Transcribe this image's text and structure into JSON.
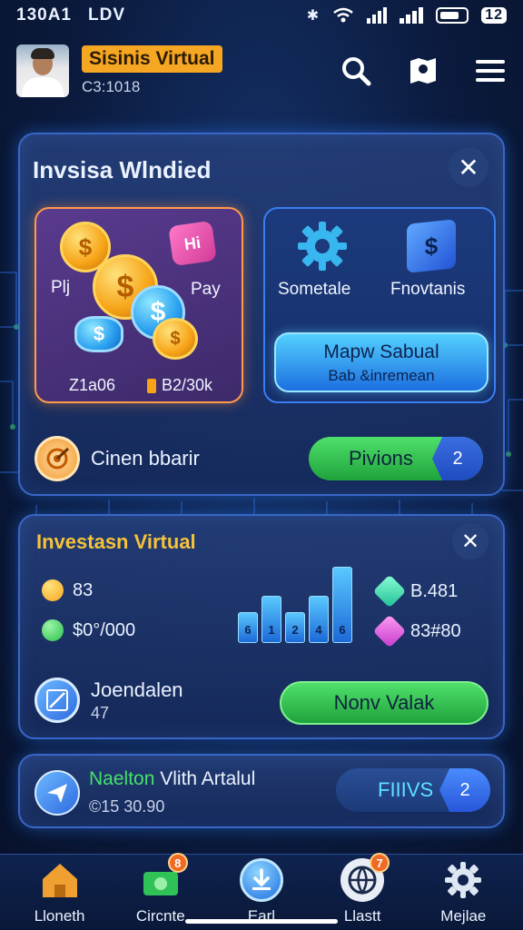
{
  "status_bar": {
    "time": "130A1",
    "carrier": "LDV",
    "battery_num": "12"
  },
  "header": {
    "user_name": "Sisinis Virtual",
    "user_id": "C3:1018"
  },
  "card1": {
    "title": "Invsisa Wlndied",
    "left_tile": {
      "label_left": "Plj",
      "label_right": "Pay",
      "amount_left": "Z1a06",
      "amount_right": "B2/30k",
      "tag": "Hi"
    },
    "right_tile": {
      "item1": "Sometale",
      "item2": "Fnovtanis",
      "cta_line1": "Mapw Sabual",
      "cta_line2": "Bab &inremean",
      "cube_symbol": "$"
    },
    "footer": {
      "label": "Cinen bbarir",
      "action": "Pivions",
      "action_symbol": "2"
    }
  },
  "card2": {
    "title": "Investasn Virtual",
    "stats_left": [
      {
        "value": "83",
        "color": "#f5a623"
      },
      {
        "value": "$0°/000",
        "color": "#3fd35c"
      }
    ],
    "stats_right": [
      {
        "value": "B.481",
        "color": "#3fe3b0"
      },
      {
        "value": "83#80",
        "color": "#e24bd8"
      }
    ],
    "bars": [
      {
        "height": 0.4,
        "label": "6"
      },
      {
        "height": 0.62,
        "label": "1"
      },
      {
        "height": 0.4,
        "label": "2"
      },
      {
        "height": 0.62,
        "label": "4"
      },
      {
        "height": 1.0,
        "label": "6"
      }
    ],
    "footer": {
      "title": "Joendalen",
      "sub": "47",
      "action": "Nonv Valak"
    }
  },
  "card3": {
    "title_accent": "Naelton",
    "title_rest": " Vlith Artalul",
    "sub": "©15 30.90",
    "action": "FIIIVS",
    "action_symbol": "2"
  },
  "nav": [
    {
      "label": "Lloneth",
      "badge": ""
    },
    {
      "label": "Circnte",
      "badge": "8"
    },
    {
      "label": "Earl",
      "badge": ""
    },
    {
      "label": "Llastt",
      "badge": "7"
    },
    {
      "label": "Mejlae",
      "badge": ""
    }
  ],
  "colors": {
    "accent_orange": "#f5a623",
    "accent_green": "#3fd35c",
    "accent_blue": "#1c6fe0"
  }
}
